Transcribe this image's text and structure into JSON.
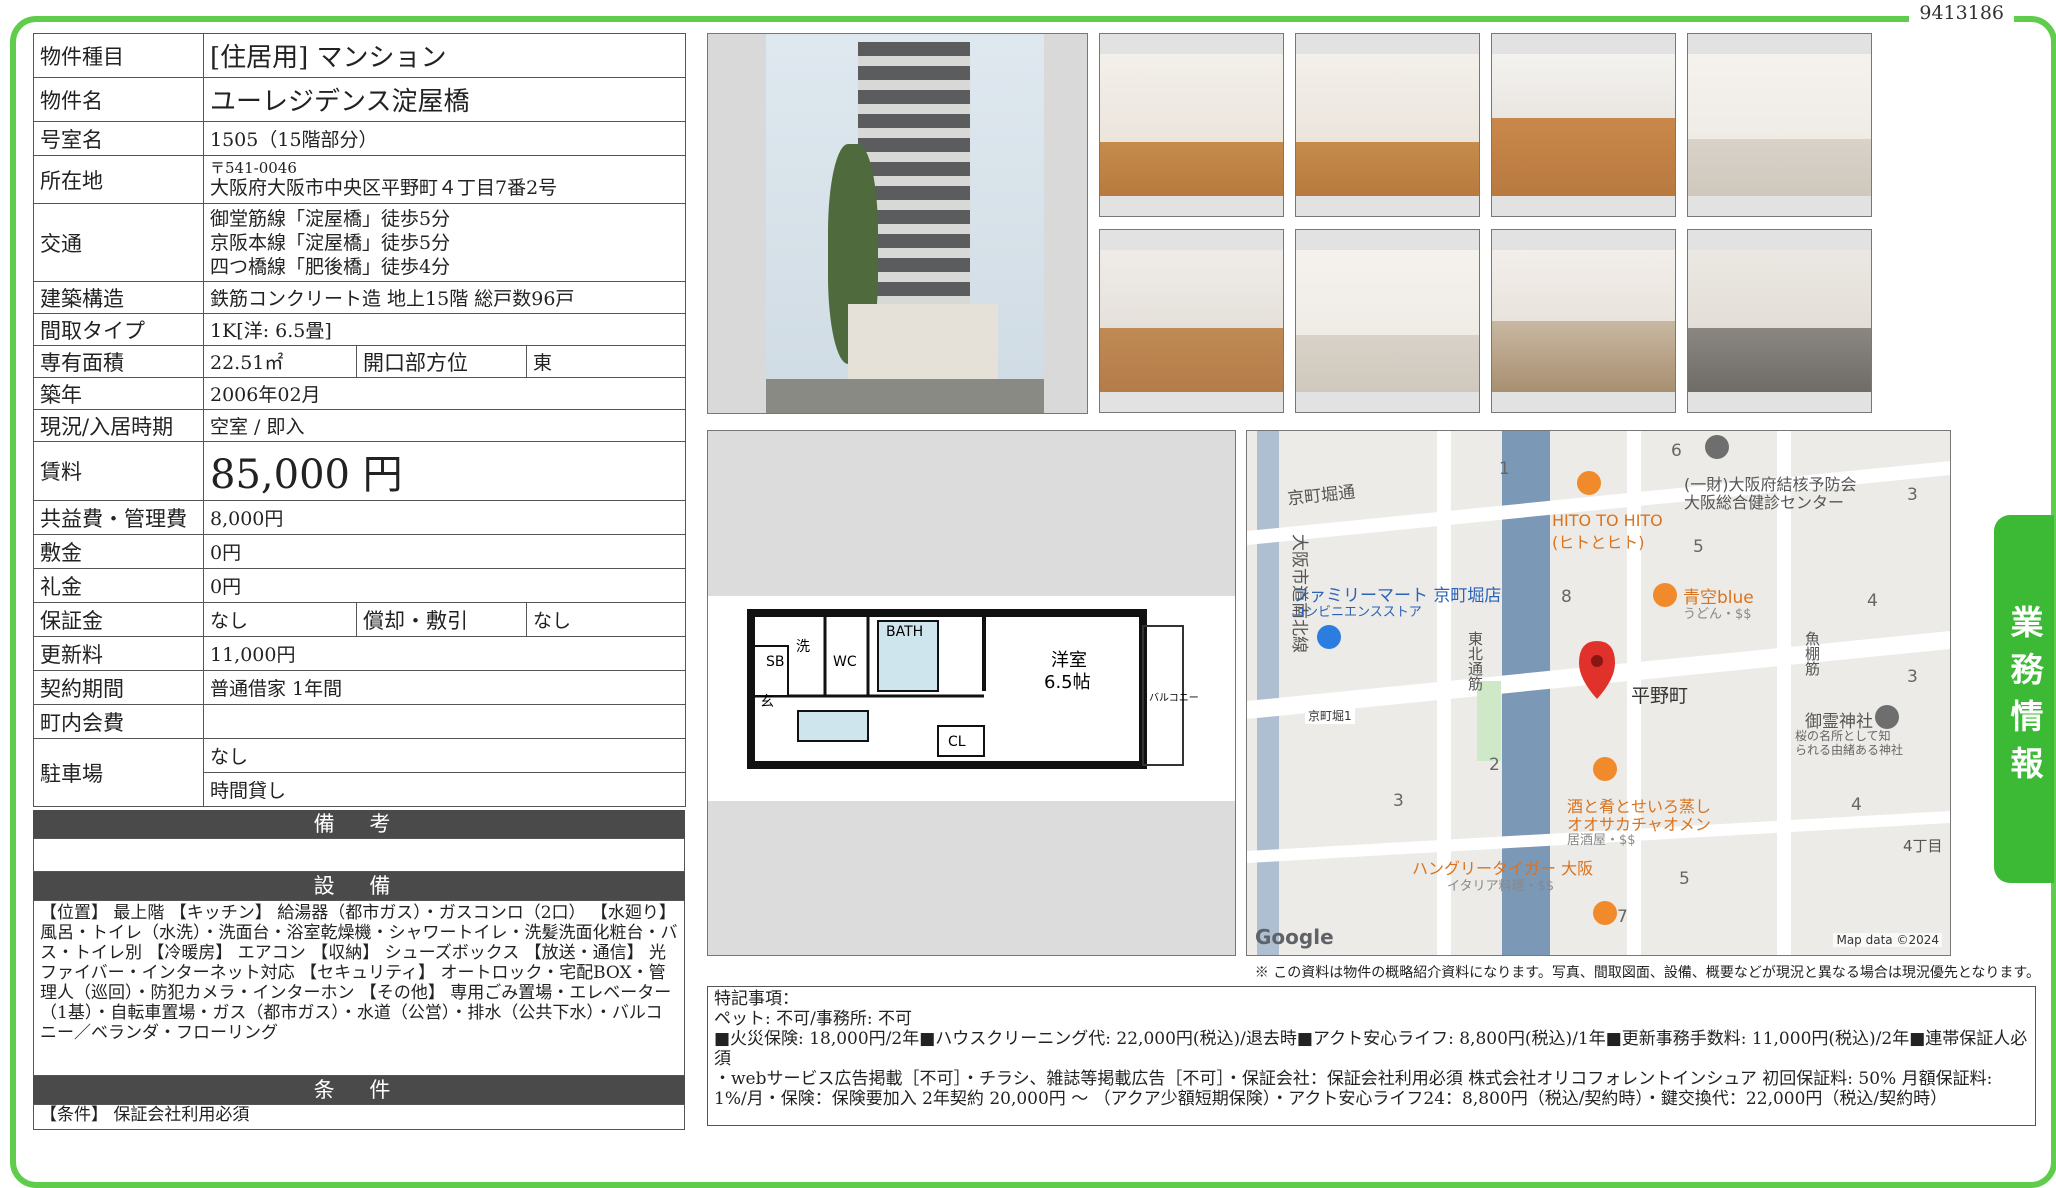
{
  "doc_id": "9413186",
  "side_tab": "業務情報",
  "spec": {
    "type_label": "物件種目",
    "type_value": "[住居用]  マンション",
    "name_label": "物件名",
    "name_value": "ユーレジデンス淀屋橋",
    "room_label": "号室名",
    "room_value": "1505（15階部分）",
    "addr_label": "所在地",
    "postal": "〒541-0046",
    "addr_value": "大阪府大阪市中央区平野町４丁目7番2号",
    "transit_label": "交通",
    "transit": [
      "御堂筋線「淀屋橋」徒歩5分",
      "京阪本線「淀屋橋」徒歩5分",
      "四つ橋線「肥後橋」徒歩4分"
    ],
    "structure_label": "建築構造",
    "structure_value": "鉄筋コンクリート造 地上15階 総戸数96戸",
    "layout_label": "間取タイプ",
    "layout_value": "1K[洋: 6.5畳]",
    "area_label": "専有面積",
    "area_value": "22.51㎡",
    "dir_label": "開口部方位",
    "dir_value": "東",
    "built_label": "築年",
    "built_value": "2006年02月",
    "status_label": "現況/入居時期",
    "status_value": "空室  /  即入",
    "rent_label": "賃料",
    "rent_value": "85,000 円",
    "fee_label": "共益費・管理費",
    "fee_value": "8,000円",
    "deposit_label": "敷金",
    "deposit_value": "0円",
    "keymoney_label": "礼金",
    "keymoney_value": "0円",
    "guarantee_label": "保証金",
    "guarantee_value": "なし",
    "amort_label": "償却・敷引",
    "amort_value": "なし",
    "renewal_label": "更新料",
    "renewal_value": "11,000円",
    "contract_label": "契約期間",
    "contract_value": "普通借家 1年間",
    "town_label": "町内会費",
    "town_value": "",
    "parking_label": "駐車場",
    "parking_value1": "なし",
    "parking_value2": "時間貸し"
  },
  "sections": {
    "remarks_title": "備 考",
    "equipment_title": "設 備",
    "conditions_title": "条 件"
  },
  "equipment_text": "【位置】 最上階 【キッチン】 給湯器（都市ガス）・ガスコンロ（2口） 【水廻り】 風呂・トイレ（水洗）・洗面台・浴室乾燥機・シャワートイレ・洗髪洗面化粧台・バス・トイレ別 【冷暖房】 エアコン 【収納】 シューズボックス 【放送・通信】 光ファイバー・インターネット対応 【セキュリティ】 オートロック・宅配BOX・管理人（巡回）・防犯カメラ・インターホン 【その他】 専用ごみ置場・エレベーター（1基）・自転車置場・ガス（都市ガス）・水道（公営）・排水（公共下水）・バルコニー／ベランダ・フローリング",
  "conditions_text": "【条件】 保証会社利用必須",
  "floorplan": {
    "room_label": "洋室",
    "room_size": "6.5帖",
    "bath": "BATH",
    "wc": "WC",
    "sb": "SB",
    "wash": "洗",
    "entry": "玄",
    "cl": "CL",
    "balcony": "バルコニー"
  },
  "map": {
    "labels": [
      "京町堀通",
      "大阪市道南北線",
      "ファミリーマート 京町堀店",
      "コンビニエンスストア",
      "HITO TO HITO",
      "(ヒトとヒト)",
      "青空blue",
      "うどん・$$",
      "(一財)大阪府結核予防会",
      "大阪総合健診センター",
      "平野町",
      "御霊神社",
      "桜の名所として知",
      "られる由緒ある神社",
      "酒と肴とせいろ蒸し",
      "オオサカチャオメン",
      "居酒屋・$$",
      "ハングリータイガー 大阪",
      "イタリア料理・$$",
      "京町堀1",
      "東北通筋",
      "魚棚筋",
      "4丁目"
    ],
    "numbers": [
      "1",
      "6",
      "3",
      "5",
      "8",
      "4",
      "3",
      "2",
      "3",
      "4",
      "5",
      "7"
    ],
    "google": "Google",
    "attribution": "Map data ©2024"
  },
  "note": "※ この資料は物件の概略紹介資料になります。写真、間取図面、設備、概要などが現況と異なる場合は現況優先となります。",
  "remarks": [
    "特記事項：",
    "ペット: 不可/事務所: 不可",
    "■火災保険: 18,000円/2年■ハウスクリーニング代: 22,000円(税込)/退去時■アクト安心ライフ: 8,800円(税込)/1年■更新事務手数料: 11,000円(税込)/2年■連帯保証人必須",
    "・webサービス広告掲載［不可］・チラシ、雑誌等掲載広告［不可］・保証会社：保証会社利用必須 株式会社オリコフォレントインシュア 初回保証料: 50% 月額保証料: 1%/月・保険：保険要加入 2年契約 20,000円 〜 （アクア少額短期保険）・アクト安心ライフ24：8,800円（税込/契約時）・鍵交換代：22,000円（税込/契約時）"
  ],
  "colors": {
    "frame": "#5fcc4c",
    "tab": "#3dba35",
    "section_header": "#4a4a4a"
  }
}
